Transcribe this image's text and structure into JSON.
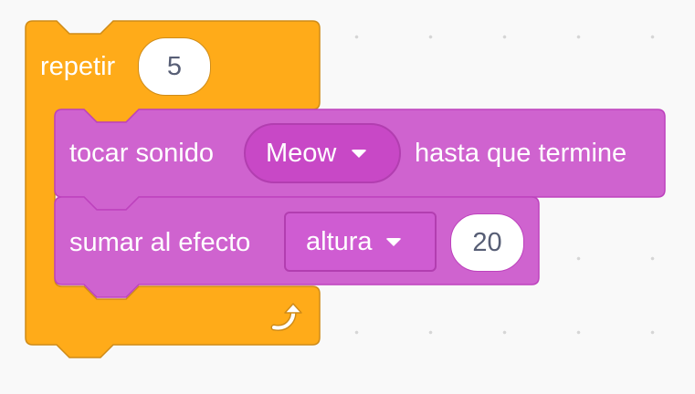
{
  "palette": {
    "control": "#ffab19",
    "control_border": "#cf8b17",
    "sound": "#cf63cf",
    "sound_border": "#bd42bd",
    "sound_dropdown": "#c94fc9",
    "reporter_text": "#575e75"
  },
  "blocks": {
    "repeat": {
      "label": "repetir",
      "count": "5",
      "loop_icon": "loop-arrow-icon"
    },
    "play_sound": {
      "label_before": "tocar sonido",
      "sound_name": "Meow",
      "label_after": "hasta que termine"
    },
    "change_effect": {
      "label": "sumar al efecto",
      "effect": "altura",
      "value": "20"
    }
  }
}
